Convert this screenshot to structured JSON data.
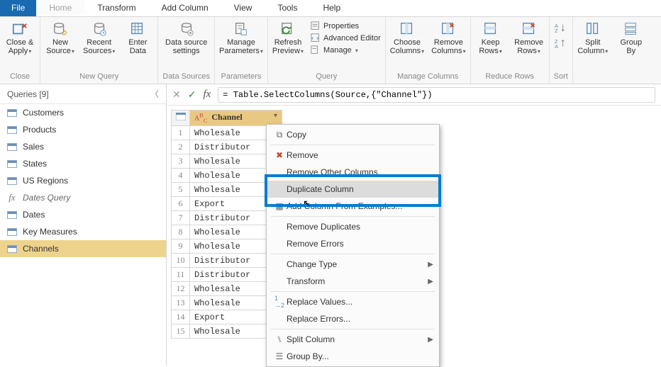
{
  "menu": {
    "file": "File",
    "tabs": [
      "Home",
      "Transform",
      "Add Column",
      "View",
      "Tools",
      "Help"
    ],
    "active": "Home"
  },
  "ribbon": {
    "close": {
      "label": "Close &\nApply",
      "group": "Close"
    },
    "newquery": {
      "new": "New\nSource",
      "recent": "Recent\nSources",
      "enter": "Enter\nData",
      "group": "New Query"
    },
    "datasources": {
      "label": "Data source\nsettings",
      "group": "Data Sources"
    },
    "parameters": {
      "label": "Manage\nParameters",
      "group": "Parameters"
    },
    "query": {
      "refresh": "Refresh\nPreview",
      "props": "Properties",
      "adv": "Advanced Editor",
      "manage": "Manage",
      "group": "Query"
    },
    "managecols": {
      "choose": "Choose\nColumns",
      "remove": "Remove\nColumns",
      "group": "Manage Columns"
    },
    "reducerows": {
      "keep": "Keep\nRows",
      "remove": "Remove\nRows",
      "group": "Reduce Rows"
    },
    "sort": {
      "group": "Sort"
    },
    "split": {
      "label": "Split\nColumn"
    },
    "groupby": {
      "label": "Group\nBy"
    }
  },
  "sidebar": {
    "title": "Queries [9]",
    "items": [
      {
        "label": "Customers"
      },
      {
        "label": "Products"
      },
      {
        "label": "Sales"
      },
      {
        "label": "States"
      },
      {
        "label": "US Regions"
      },
      {
        "label": "Dates Query",
        "fx": true
      },
      {
        "label": "Dates"
      },
      {
        "label": "Key Measures"
      },
      {
        "label": "Channels",
        "selected": true
      }
    ]
  },
  "formula": "= Table.SelectColumns(Source,{\"Channel\"})",
  "column": {
    "name": "Channel",
    "type_prefix": "A",
    "type_suffix": "C"
  },
  "rows": [
    "Wholesale",
    "Distributor",
    "Wholesale",
    "Wholesale",
    "Wholesale",
    "Export",
    "Distributor",
    "Wholesale",
    "Wholesale",
    "Distributor",
    "Distributor",
    "Wholesale",
    "Wholesale",
    "Export",
    "Wholesale"
  ],
  "ctx": {
    "copy": "Copy",
    "remove": "Remove",
    "remove_other": "Remove Other Columns",
    "duplicate": "Duplicate Column",
    "add_examples": "Add Column From Examples...",
    "remove_dup": "Remove Duplicates",
    "remove_err": "Remove Errors",
    "change_type": "Change Type",
    "transform": "Transform",
    "replace_values": "Replace Values...",
    "replace_errors": "Replace Errors...",
    "split_column": "Split Column",
    "group_by": "Group By..."
  }
}
